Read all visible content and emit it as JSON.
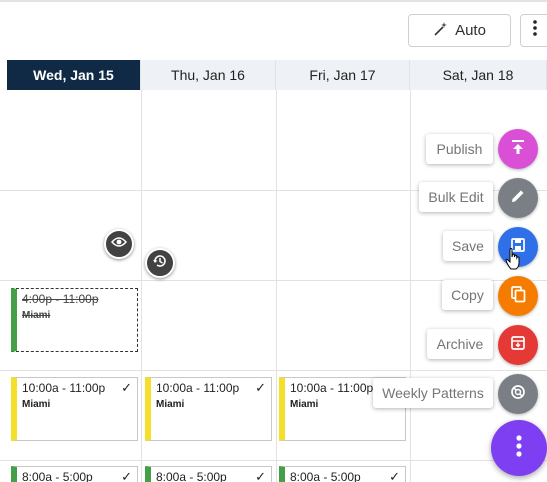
{
  "toolbar": {
    "auto_label": "Auto",
    "auto_icon": "magic-wand-icon",
    "more_icon": "more-vert-icon"
  },
  "days": [
    {
      "label": "Wed, Jan 15",
      "active": true
    },
    {
      "label": "Thu, Jan 16",
      "active": false
    },
    {
      "label": "Fri, Jan 17",
      "active": false
    },
    {
      "label": "Sat, Jan 18",
      "active": false
    }
  ],
  "shifts": {
    "deleted": {
      "time": "4:00p - 11:00p",
      "location": "Miami"
    },
    "row1": [
      {
        "time": "10:00a - 11:00p",
        "location": "Miami",
        "color": "#f4df2a"
      },
      {
        "time": "10:00a - 11:00p",
        "location": "Miami",
        "color": "#f4df2a"
      },
      {
        "time": "10:00a - 11:00p",
        "location": "Miami",
        "color": "#f4df2a"
      }
    ],
    "row2": [
      {
        "time": "8:00a - 5:00p",
        "color": "#43a047"
      },
      {
        "time": "8:00a - 5:00p",
        "color": "#43a047"
      },
      {
        "time": "8:00a - 5:00p",
        "color": "#43a047"
      }
    ]
  },
  "floating_icons": {
    "view": "eye-icon",
    "restore": "history-icon"
  },
  "fab_menu": {
    "publish": {
      "label": "Publish",
      "icon": "publish-icon",
      "color": "#d94fd6"
    },
    "bulk_edit": {
      "label": "Bulk Edit",
      "icon": "pencil-icon",
      "color": "#7a7f85"
    },
    "save": {
      "label": "Save",
      "icon": "save-icon",
      "color": "#2f6fe8"
    },
    "copy": {
      "label": "Copy",
      "icon": "copy-icon",
      "color": "#f57c00"
    },
    "archive": {
      "label": "Archive",
      "icon": "archive-icon",
      "color": "#e53935"
    },
    "weekly_patterns": {
      "label": "Weekly Patterns",
      "icon": "patterns-icon",
      "color": "#7a7f85"
    },
    "main_icon": "more-vert-icon",
    "main_color": "#7e3ff2"
  }
}
